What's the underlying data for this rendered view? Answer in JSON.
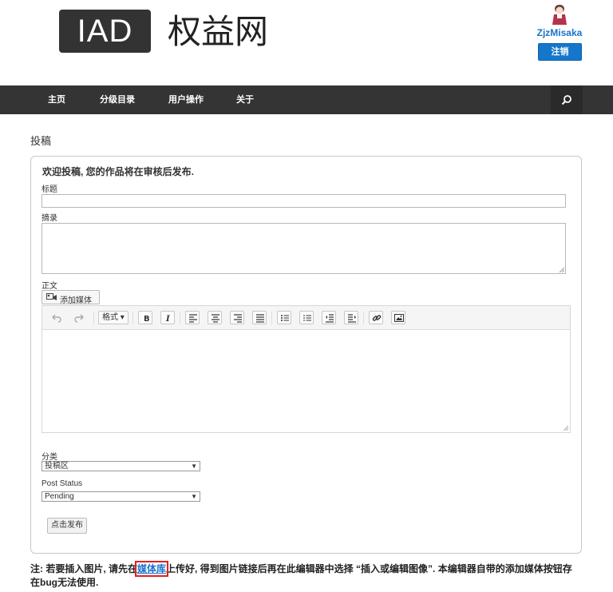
{
  "header": {
    "logo_text": "IAD",
    "site_name": "权益网",
    "username": "ZjzMisaka",
    "logout_label": "注销"
  },
  "nav": {
    "items": [
      "主页",
      "分级目录",
      "用户操作",
      "关于"
    ],
    "search_icon": "search-icon"
  },
  "page": {
    "title": "投稿"
  },
  "form": {
    "welcome": "欢迎投稿, 您的作品将在审核后发布.",
    "title_label": "标题",
    "title_value": "",
    "excerpt_label": "摘录",
    "excerpt_value": "",
    "body_label": "正文",
    "add_media_label": "添加媒体",
    "format_label": "格式",
    "category_label": "分类",
    "category_value": "投稿区",
    "status_label": "Post Status",
    "status_value": "Pending",
    "submit_label": "点击发布"
  },
  "note": {
    "prefix": "注: 若要插入图片, 请先在",
    "link": "媒体库",
    "suffix": "上传好, 得到图片链接后再在此编辑器中选择 “插入或编辑图像”. 本编辑器自带的添加媒体按钮存在bug无法使用."
  },
  "colors": {
    "nav_bg": "#343434",
    "accent_blue": "#1577cc",
    "link_highlight": "#e02020"
  }
}
